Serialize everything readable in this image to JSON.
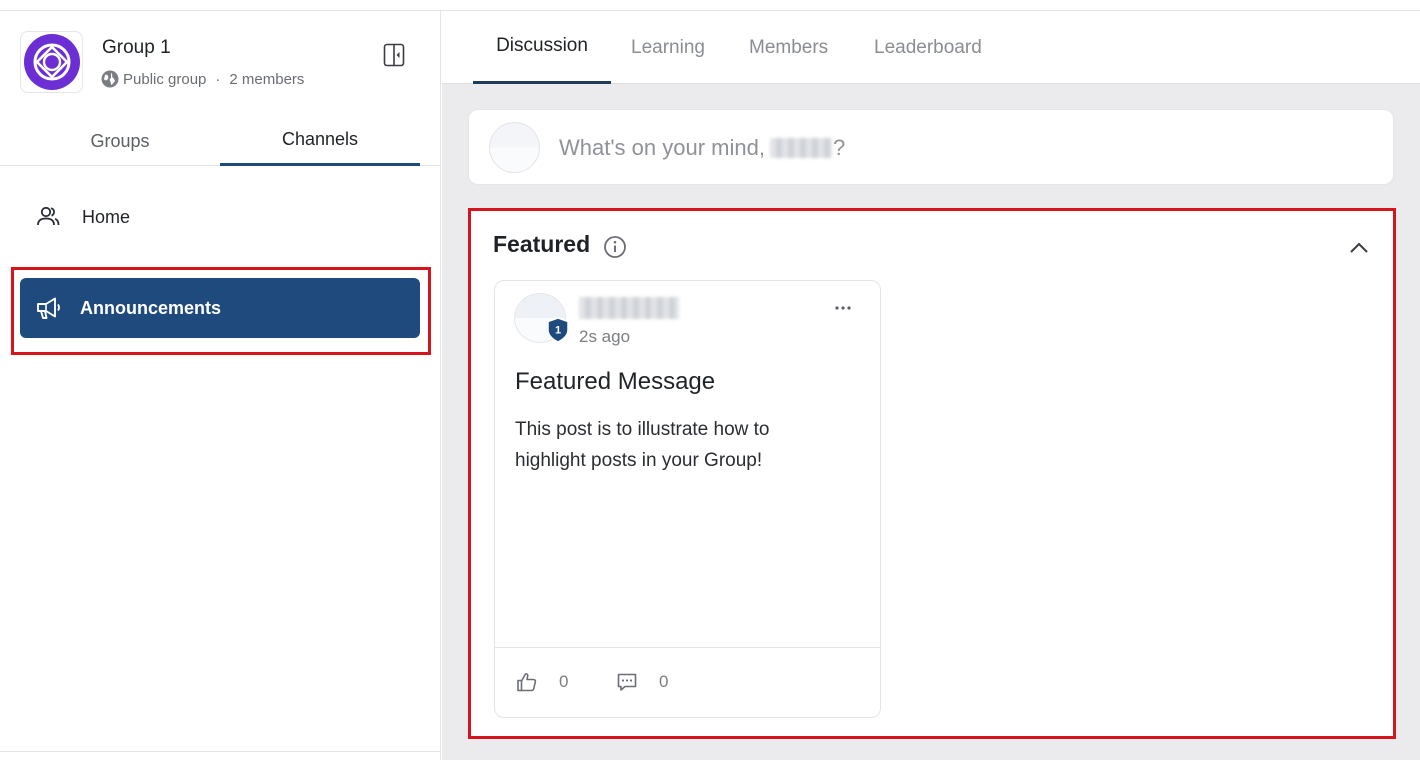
{
  "group": {
    "name": "Group 1",
    "visibility": "Public group",
    "separator": "·",
    "members": "2 members",
    "avatar_color": "#6b2fd3"
  },
  "sidebar": {
    "tabs": [
      "Groups",
      "Channels"
    ],
    "active_tab": "Channels",
    "items": [
      {
        "label": "Home",
        "icon": "users-icon"
      },
      {
        "label": "Announcements",
        "icon": "megaphone-icon",
        "selected": true
      }
    ],
    "selected_color": "#1e4a7e",
    "collapse_icon": "sidebar-collapse-icon"
  },
  "main": {
    "tabs": [
      "Discussion",
      "Learning",
      "Members",
      "Leaderboard"
    ],
    "active_tab": "Discussion",
    "composer": {
      "placeholder_prefix": "What's on your mind,",
      "placeholder_suffix": "?"
    },
    "featured": {
      "title": "Featured",
      "info_icon": "info-icon",
      "collapse_icon": "chevron-up-icon",
      "post": {
        "badge_level": "1",
        "time": "2s ago",
        "title": "Featured Message",
        "body": "This post is to illustrate how to highlight posts in your Group!",
        "likes": "0",
        "comments": "0"
      }
    }
  },
  "highlight_color": "#d5141c"
}
